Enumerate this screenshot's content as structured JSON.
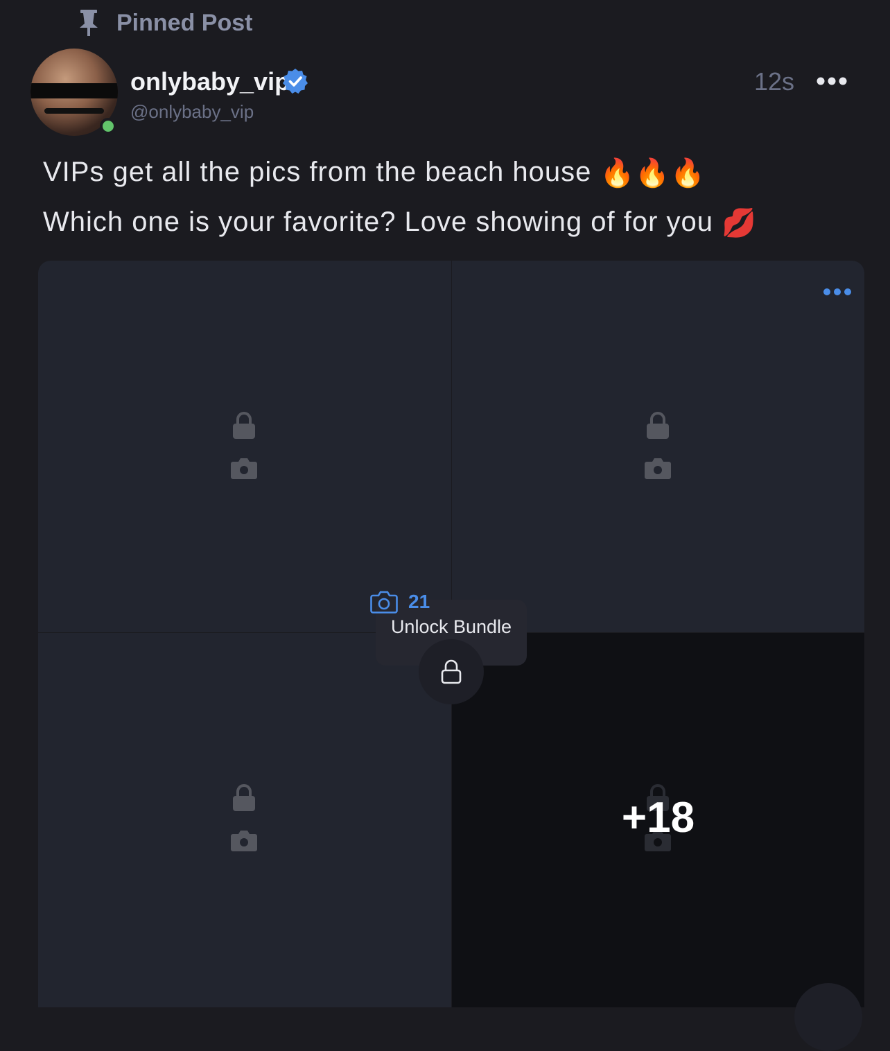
{
  "pinned": {
    "label": "Pinned Post",
    "icon": "pin-icon"
  },
  "author": {
    "display_name": "onlybaby_vip",
    "username": "@onlybaby_vip",
    "verified": true,
    "online": true
  },
  "post": {
    "timestamp": "12s",
    "text_line1": "VIPs get all the pics from the beach house",
    "text_line1_emoji": "🔥🔥🔥",
    "text_line2": "Which one is your favorite? Love showing of for you",
    "text_line2_emoji": "💋"
  },
  "media": {
    "tiles": [
      {
        "locked": true,
        "type": "photo"
      },
      {
        "locked": true,
        "type": "photo"
      },
      {
        "locked": true,
        "type": "photo"
      },
      {
        "locked": true,
        "type": "photo",
        "overlay": "+18"
      }
    ],
    "more_count": "+18"
  },
  "bundle": {
    "photo_count": "21",
    "label": "Unlock Bundle"
  },
  "colors": {
    "background": "#1b1b20",
    "accent": "#4a8de8",
    "online": "#62c46b",
    "muted": "#6b7187"
  }
}
